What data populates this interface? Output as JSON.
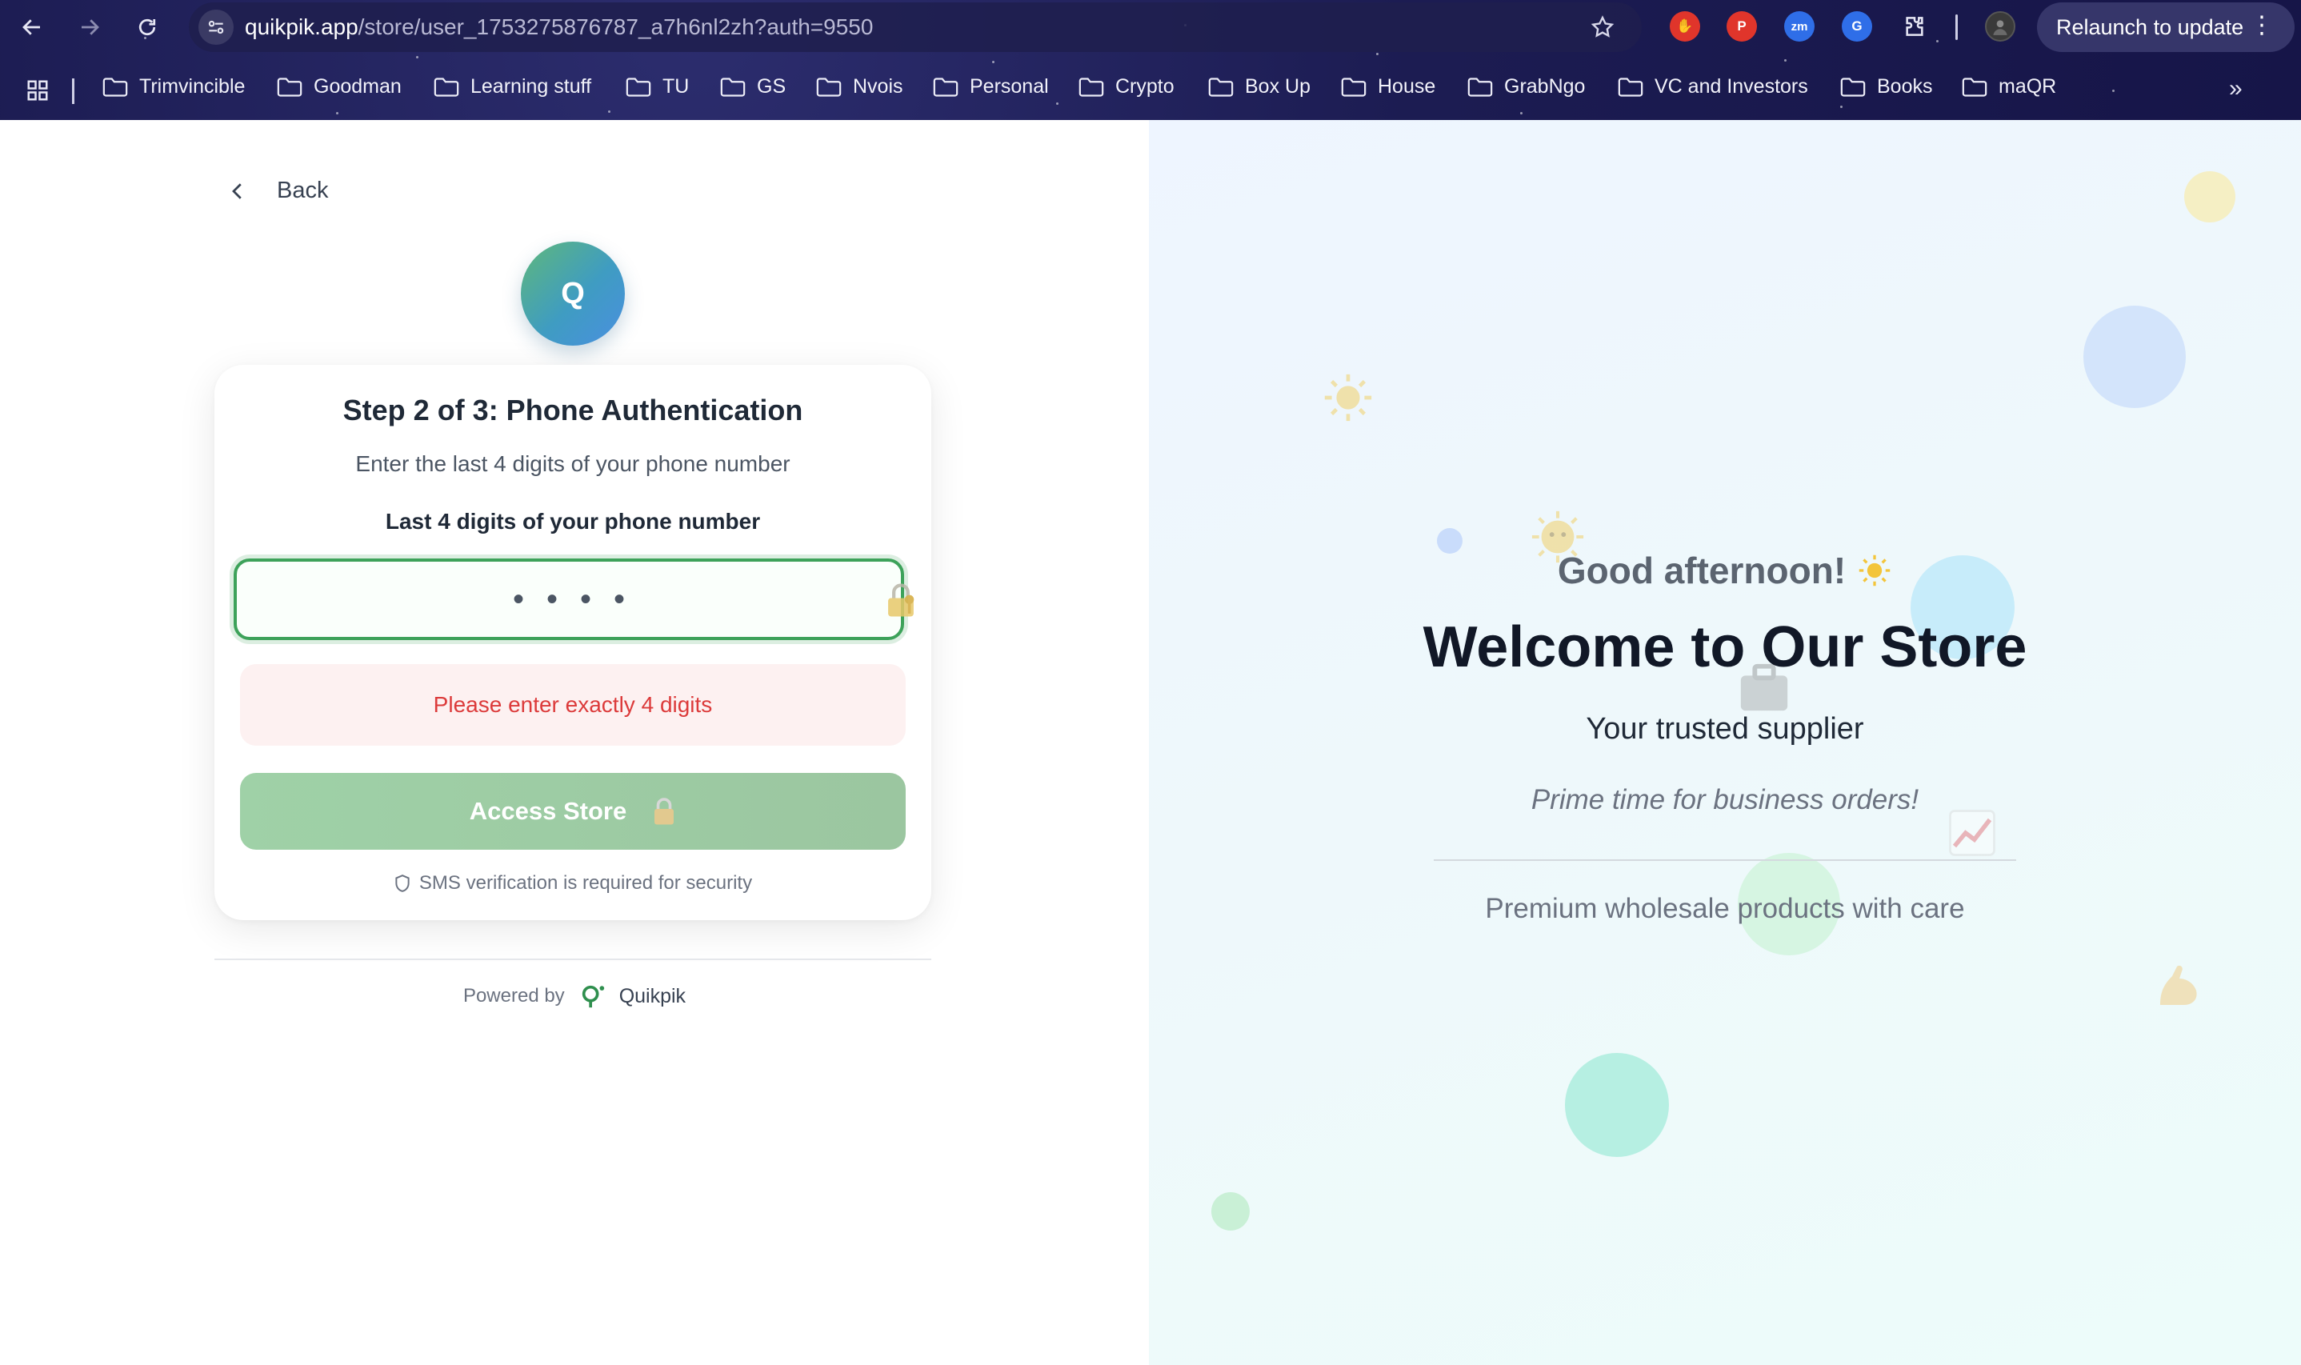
{
  "browser": {
    "url_host": "quikpik.app",
    "url_path": "/store/user_1753275876787_a7h6nl2zh?auth=9550",
    "relaunch_label": "Relaunch to update",
    "extensions": [
      {
        "name": "hand-extension-icon",
        "color": "#e0352b",
        "glyph": "✋"
      },
      {
        "name": "pinterest-icon",
        "color": "#e0352b",
        "glyph": "P"
      },
      {
        "name": "zoom-icon",
        "color": "#2f6ee8",
        "glyph": "zm"
      },
      {
        "name": "grammarly-icon",
        "color": "#2f6ee8",
        "glyph": "G"
      }
    ],
    "bookmarks": [
      "Trimvincible",
      "Goodman",
      "Learning stuff",
      "TU",
      "GS",
      "Nvois",
      "Personal",
      "Crypto",
      "Box Up",
      "House",
      "GrabNgo",
      "VC and Investors",
      "Books",
      "maQR"
    ]
  },
  "left": {
    "back_label": "Back",
    "logo_letter": "Q",
    "card": {
      "title": "Step 2 of 3: Phone Authentication",
      "subtitle": "Enter the last 4 digits of your phone number",
      "field_label": "Last 4 digits of your phone number",
      "input_value": "••••",
      "error": "Please enter exactly 4 digits",
      "submit_label": "Access Store",
      "security_note": "SMS verification is required for security"
    },
    "powered_by": "Powered by",
    "brand_name": "Quikpik"
  },
  "right": {
    "greeting": "Good afternoon!",
    "welcome": "Welcome to Our Store",
    "tagline": "Your trusted supplier",
    "motto": "Prime time for business orders!",
    "description": "Premium wholesale products with care"
  },
  "colors": {
    "accent_green": "#3da25a",
    "button_green": "#9fd1a7",
    "error_red": "#dc3b3b",
    "chrome_bg": "#1c1c52"
  }
}
